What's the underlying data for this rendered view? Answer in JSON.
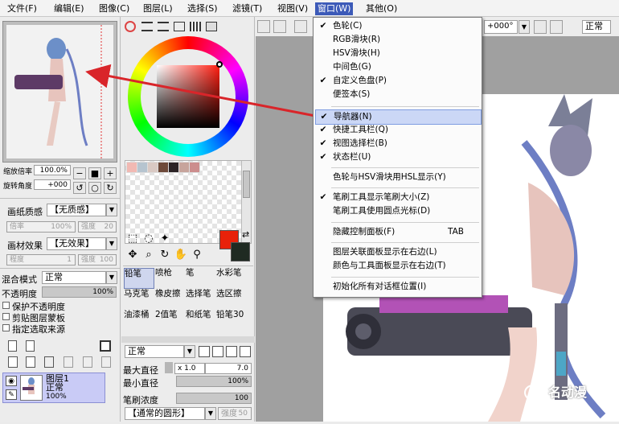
{
  "menubar": {
    "items": [
      "文件(F)",
      "编辑(E)",
      "图像(C)",
      "图层(L)",
      "选择(S)",
      "滤镜(T)",
      "视图(V)",
      "窗口(W)",
      "其他(O)"
    ]
  },
  "view_toolbar": {
    "rotation_value": "+000°",
    "blend_value": "正常"
  },
  "navigator": {
    "zoom_label": "缩放倍率",
    "zoom_value": "100.0%",
    "rotate_label": "旋转角度",
    "rotate_value": "+000",
    "zoom_out": "−",
    "zoom_fit": "■",
    "zoom_in": "+",
    "rot_left": "↺",
    "rot_reset": "○",
    "rot_right": "↻"
  },
  "layer_panel": {
    "paper_texture_label": "画纸质感",
    "paper_texture_value": "【无质感】",
    "scale_label": "倍率",
    "scale_value": "100%",
    "intensity_label": "强度",
    "intensity_value": "20",
    "paper_effect_label": "画材效果",
    "paper_effect_value": "【无效果】",
    "degree_label": "程度",
    "degree_value": "1",
    "strength_label": "强度",
    "strength_value": "100",
    "blend_mode_label": "混合模式",
    "blend_mode_value": "正常",
    "opacity_label": "不透明度",
    "opacity_value": "100%",
    "checkboxes": [
      "保护不透明度",
      "剪贴图层蒙板",
      "指定选取来源"
    ],
    "layer_name": "图层1",
    "layer_mode": "正常",
    "layer_opacity": "100%"
  },
  "color_panel": {
    "swatch_colors": [
      "#f1b9b3",
      "#b6c4cf",
      "#d9c9c3",
      "#6e4a3a",
      "#2c2326",
      "#c7a49c",
      "#cc8d8d"
    ],
    "primary_color": "#e8220a",
    "secondary_color": "#1f2a22"
  },
  "brush_panel": {
    "brushes": [
      "铅笔",
      "喷枪",
      "笔",
      "水彩笔",
      "马克笔",
      "橡皮擦",
      "选择笔",
      "选区擦",
      "油漆桶",
      "2值笔",
      "和纸笔",
      "铅笔30"
    ],
    "blend_value": "正常",
    "max_diameter_label": "最大直径",
    "max_diameter_mult": "x 1.0",
    "max_diameter_value": "7.0",
    "min_diameter_label": "最小直径",
    "min_diameter_value": "100%",
    "density_label": "笔刷浓度",
    "density_value": "100",
    "shape_value": "【通常的圆形】",
    "shape_strength_label": "强度",
    "shape_strength_value": "50"
  },
  "window_menu": {
    "items": [
      {
        "label": "色轮(C)",
        "checked": true,
        "shortcut": ""
      },
      {
        "label": "RGB滑块(R)",
        "checked": false,
        "shortcut": ""
      },
      {
        "label": "HSV滑块(H)",
        "checked": false,
        "shortcut": ""
      },
      {
        "label": "中间色(G)",
        "checked": false,
        "shortcut": ""
      },
      {
        "label": "自定义色盘(P)",
        "checked": true,
        "shortcut": ""
      },
      {
        "label": "便签本(S)",
        "checked": false,
        "shortcut": ""
      },
      {
        "label": "导航器(N)",
        "checked": true,
        "shortcut": ""
      },
      {
        "label": "快捷工具栏(Q)",
        "checked": true,
        "shortcut": ""
      },
      {
        "label": "视图选择栏(B)",
        "checked": true,
        "shortcut": ""
      },
      {
        "label": "状态栏(U)",
        "checked": true,
        "shortcut": ""
      },
      {
        "label": "色轮与HSV滑块用HSL显示(Y)",
        "checked": false,
        "shortcut": ""
      },
      {
        "label": "笔刷工具显示笔刷大小(Z)",
        "checked": true,
        "shortcut": ""
      },
      {
        "label": "笔刷工具使用圆点光标(D)",
        "checked": false,
        "shortcut": ""
      },
      {
        "label": "隐藏控制面板(F)",
        "checked": false,
        "shortcut": "TAB"
      },
      {
        "label": "图层关联面板显示在右边(L)",
        "checked": false,
        "shortcut": ""
      },
      {
        "label": "颜色与工具面板显示在右边(T)",
        "checked": false,
        "shortcut": ""
      },
      {
        "label": "初始化所有对话框位置(I)",
        "checked": false,
        "shortcut": ""
      }
    ]
  },
  "watermark": {
    "text": "名动漫"
  },
  "colors": {
    "menu_active": "#3c5ab8",
    "highlight": "#cbd7f6",
    "canvas_gray": "#a0a0a0",
    "arrow": "#d9252a"
  }
}
